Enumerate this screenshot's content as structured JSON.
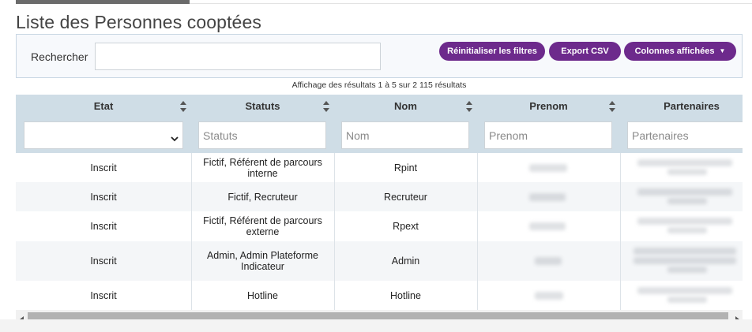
{
  "page": {
    "title": "Liste des Personnes cooptées"
  },
  "filters": {
    "search_label": "Rechercher",
    "search_value": "",
    "buttons": {
      "reset": "Réinitialiser les filtres",
      "export": "Export CSV",
      "columns": "Colonnes affichées"
    }
  },
  "results_info": "Affichage des résultats 1 à 5 sur 2 115 résultats",
  "table": {
    "columns": [
      {
        "label": "Etat",
        "filter_placeholder": "",
        "filter_type": "select"
      },
      {
        "label": "Statuts",
        "filter_placeholder": "Statuts",
        "filter_type": "text"
      },
      {
        "label": "Nom",
        "filter_placeholder": "Nom",
        "filter_type": "text"
      },
      {
        "label": "Prenom",
        "filter_placeholder": "Prenom",
        "filter_type": "text"
      },
      {
        "label": "Partenaires",
        "filter_placeholder": "Partenaires",
        "filter_type": "text"
      }
    ],
    "rows": [
      {
        "etat": "Inscrit",
        "statuts": "Fictif, Référent de parcours interne",
        "nom": "Rpint"
      },
      {
        "etat": "Inscrit",
        "statuts": "Fictif, Recruteur",
        "nom": "Recruteur"
      },
      {
        "etat": "Inscrit",
        "statuts": "Fictif, Référent de parcours externe",
        "nom": "Rpext"
      },
      {
        "etat": "Inscrit",
        "statuts": "Admin, Admin Plateforme Indicateur",
        "nom": "Admin"
      },
      {
        "etat": "Inscrit",
        "statuts": "Hotline",
        "nom": "Hotline"
      }
    ]
  },
  "colors": {
    "accent": "#6d2a8c",
    "header_bg": "#cfdde6",
    "row_alt": "#f4f6f8"
  },
  "icons": {
    "sort": "sort-arrows-icon",
    "select_caret": "chevron-down-icon",
    "button_caret": "caret-down-icon"
  }
}
